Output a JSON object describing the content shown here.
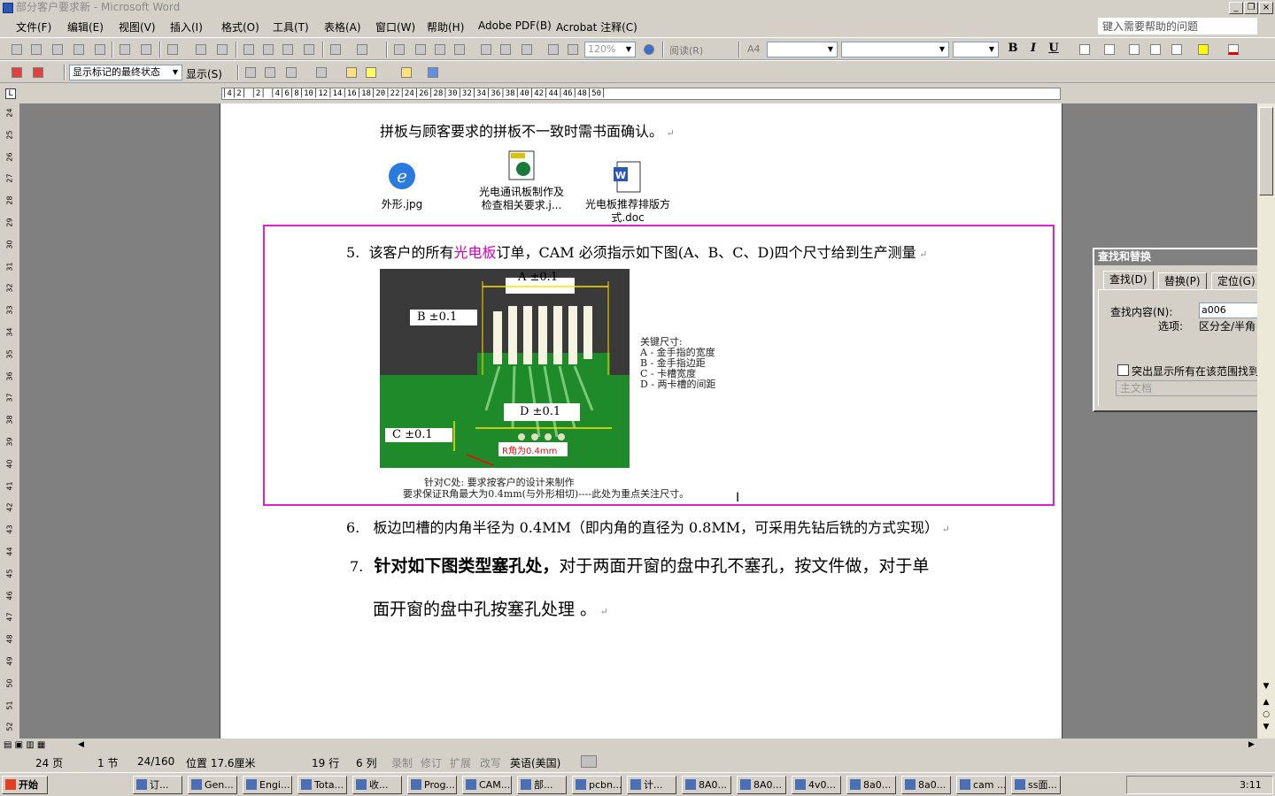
{
  "window": {
    "title": "部分客户要求新 - Microsoft Word",
    "minimize": "_",
    "restore": "❐",
    "close": "×"
  },
  "menu": [
    "文件(F)",
    "编辑(E)",
    "视图(V)",
    "插入(I)",
    "格式(O)",
    "工具(T)",
    "表格(A)",
    "窗口(W)",
    "帮助(H)",
    "Adobe PDF(B)",
    "Acrobat 注释(C)"
  ],
  "help_placeholder": "键入需要帮助的问题",
  "toolbar": {
    "zoom": "120%",
    "read": "阅读(R)",
    "style_icon": "A4",
    "bold": "B",
    "italic": "I",
    "underline": "U"
  },
  "review_toolbar": {
    "markup_state": "显示标记的最终状态",
    "show": "显示(S)"
  },
  "ruler_text": "│4│2│ │2│ │4│6│8│10│12│14│16│18│20│22│24│26│28│30│32│34│36│38│40│42│44│46│48│50│",
  "vruler_ticks": [
    "24",
    "25",
    "26",
    "27",
    "28",
    "29",
    "30",
    "31",
    "32",
    "33",
    "34",
    "35",
    "36",
    "37",
    "38",
    "39",
    "40",
    "41",
    "42",
    "43",
    "44",
    "45",
    "46",
    "47",
    "48",
    "49",
    "50",
    "51",
    "52"
  ],
  "doc": {
    "line_top": "拼板与顾客要求的拼板不一致时需书面确认。",
    "attachments": [
      {
        "icon": "ie-icon",
        "label": "外形.jpg"
      },
      {
        "icon": "jpg-icon",
        "label": "光电通讯板制作及\n检查相关要求.j..."
      },
      {
        "icon": "word-doc-icon",
        "label": "光电板推荐排版方\n式.doc"
      }
    ],
    "item5": {
      "num": "5.",
      "pre": "该客户的所有",
      "highlight": "光电板",
      "post": "订单，CAM 必须指示如下图(A、B、C、D)四个尺寸给到生产测量"
    },
    "figure": {
      "labels": {
        "a": "A ±0.1",
        "b": "B ±0.1",
        "c": "C ±0.1",
        "d": "D ±0.1",
        "r": "R角为0.4mm"
      },
      "key_title": "关键尺寸:",
      "key_items": [
        "A - 金手指的宽度",
        "B - 金手指边距",
        "C - 卡槽宽度",
        "D -  两卡槽的间距"
      ],
      "caption1": "针对C处: 要求按客户的设计来制作",
      "caption2": "要求保证R角最大为0.4mm(与外形相切)----此处为重点关注尺寸。"
    },
    "item6": {
      "num": "6.",
      "text": "板边凹槽的内角半径为 0.4MM（即内角的直径为 0.8MM，可采用先钻后铣的方式实现）"
    },
    "item7": {
      "num": "7.",
      "bold": "针对如下图类型塞孔处，",
      "rest": "对于两面开窗的盘中孔不塞孔，按文件做，对于单",
      "line2": "面开窗的盘中孔按塞孔处理 。"
    }
  },
  "dialog": {
    "title": "查找和替换",
    "tabs": [
      "查找(D)",
      "替换(P)",
      "定位(G)"
    ],
    "find_label": "查找内容(N):",
    "find_value": "a006",
    "options_label": "选项:",
    "options_value": "区分全/半角",
    "highlight_label": "突出显示所有在该范围找到的项",
    "scope": "主文档"
  },
  "status": {
    "page": "24 页",
    "section": "1 节",
    "pages": "24/160",
    "pos": "位置 17.6厘米",
    "line": "19 行",
    "col": "6 列",
    "rec": "录制",
    "trk": "修订",
    "ext": "扩展",
    "ovr": "改写",
    "lang": "英语(美国)"
  },
  "taskbar": {
    "start": "开始",
    "clock": "3:11",
    "tasks": [
      "订...",
      "Gen...",
      "Engi...",
      "Tota...",
      "收...",
      "Prog...",
      "CAM...",
      "部...",
      "pcbn...",
      "计...",
      "8A0...",
      "8A0...",
      "4v0...",
      "8a0...",
      "8a0...",
      "cam ...",
      "ss面..."
    ]
  },
  "colors": {
    "magenta_frame": "#e020d0",
    "highlight": "#d000c0",
    "pcb_green": "#1f8a2a"
  }
}
